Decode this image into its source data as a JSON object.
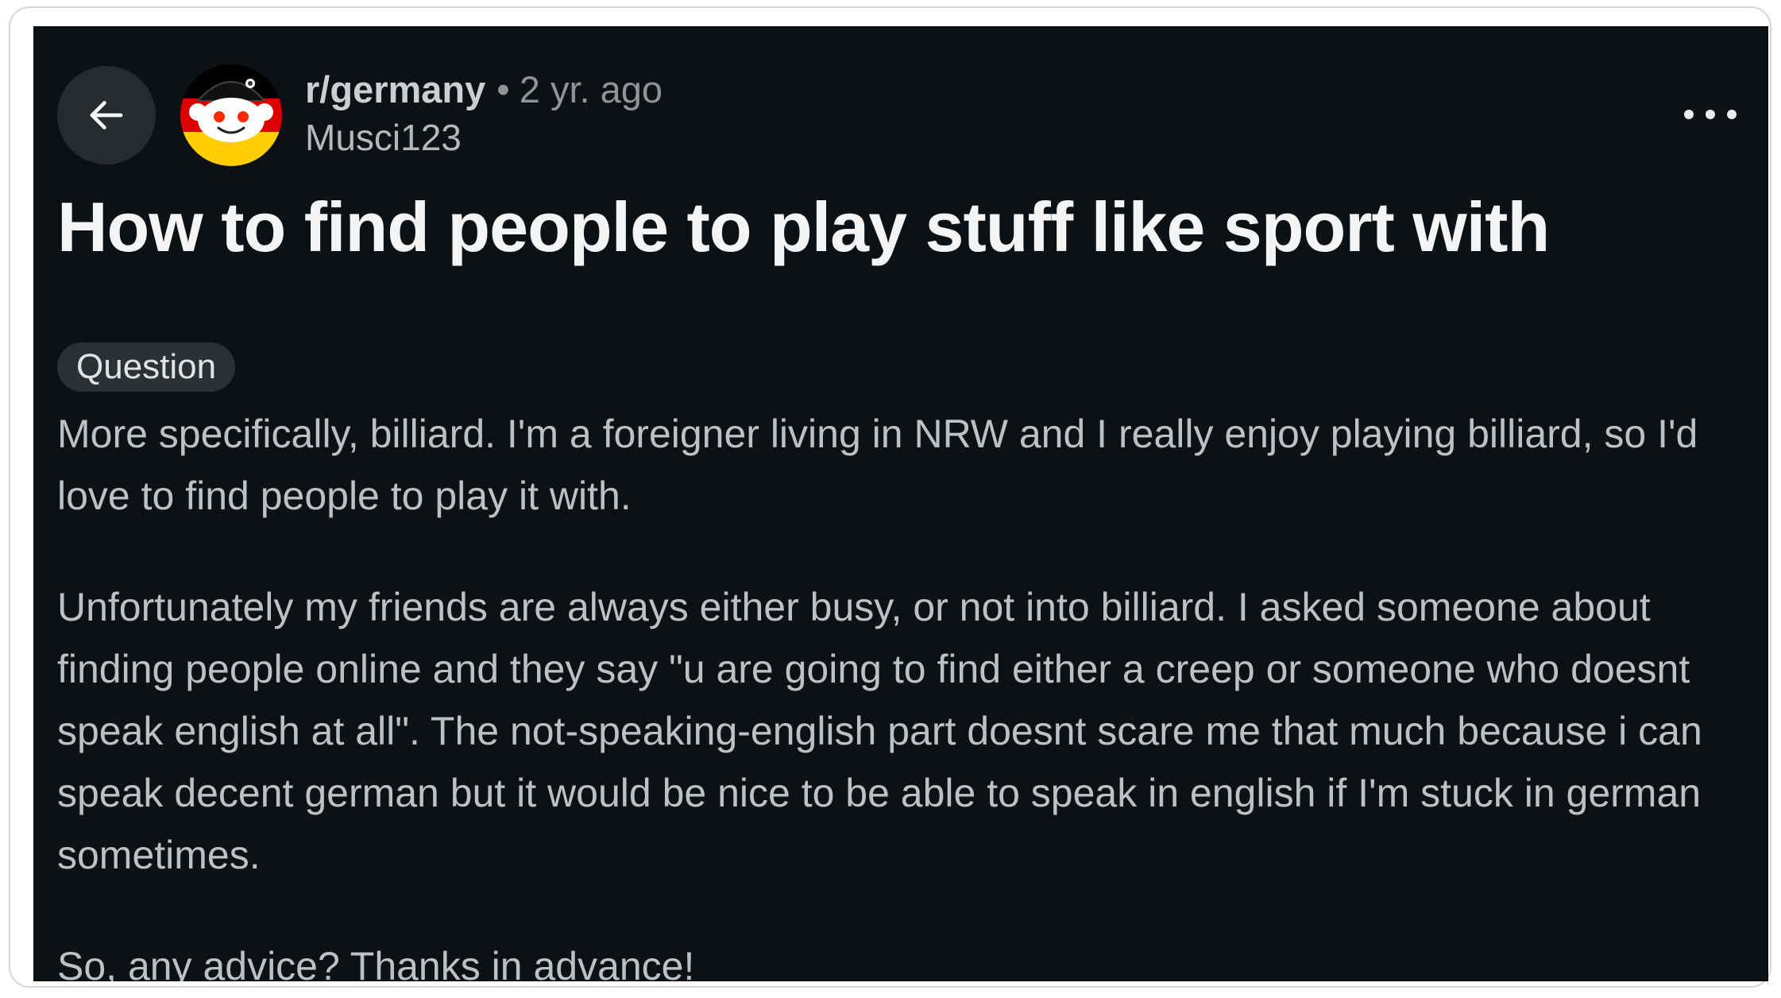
{
  "post": {
    "subreddit": "r/germany",
    "separator": "•",
    "time_ago": "2 yr. ago",
    "author": "Musci123",
    "title": "How to find people to play stuff like sport with",
    "flair": "Question",
    "paragraphs": [
      "More specifically, billiard. I'm a foreigner living in NRW and I really enjoy playing billiard, so I'd love to find people to play it with.",
      "Unfortunately my friends are always either busy, or not into billiard. I asked someone about finding people online and they say \"u are going to find either a creep or someone who doesnt speak english at all\". The not-speaking-english part doesnt scare me that much because i can speak decent german but it would be nice to be able to speak in english if I'm stuck in german sometimes.",
      "So, any advice? Thanks in advance!"
    ]
  },
  "icons": {
    "back": "arrow-left-icon",
    "more": "more-options-icon",
    "avatar": "subreddit-avatar"
  },
  "colors": {
    "background": "#0e1113",
    "button_bg": "#272b2e",
    "flair_bg": "#2b3134",
    "flag_black": "#000000",
    "flag_red": "#dd0000",
    "flag_gold": "#ffce00"
  }
}
